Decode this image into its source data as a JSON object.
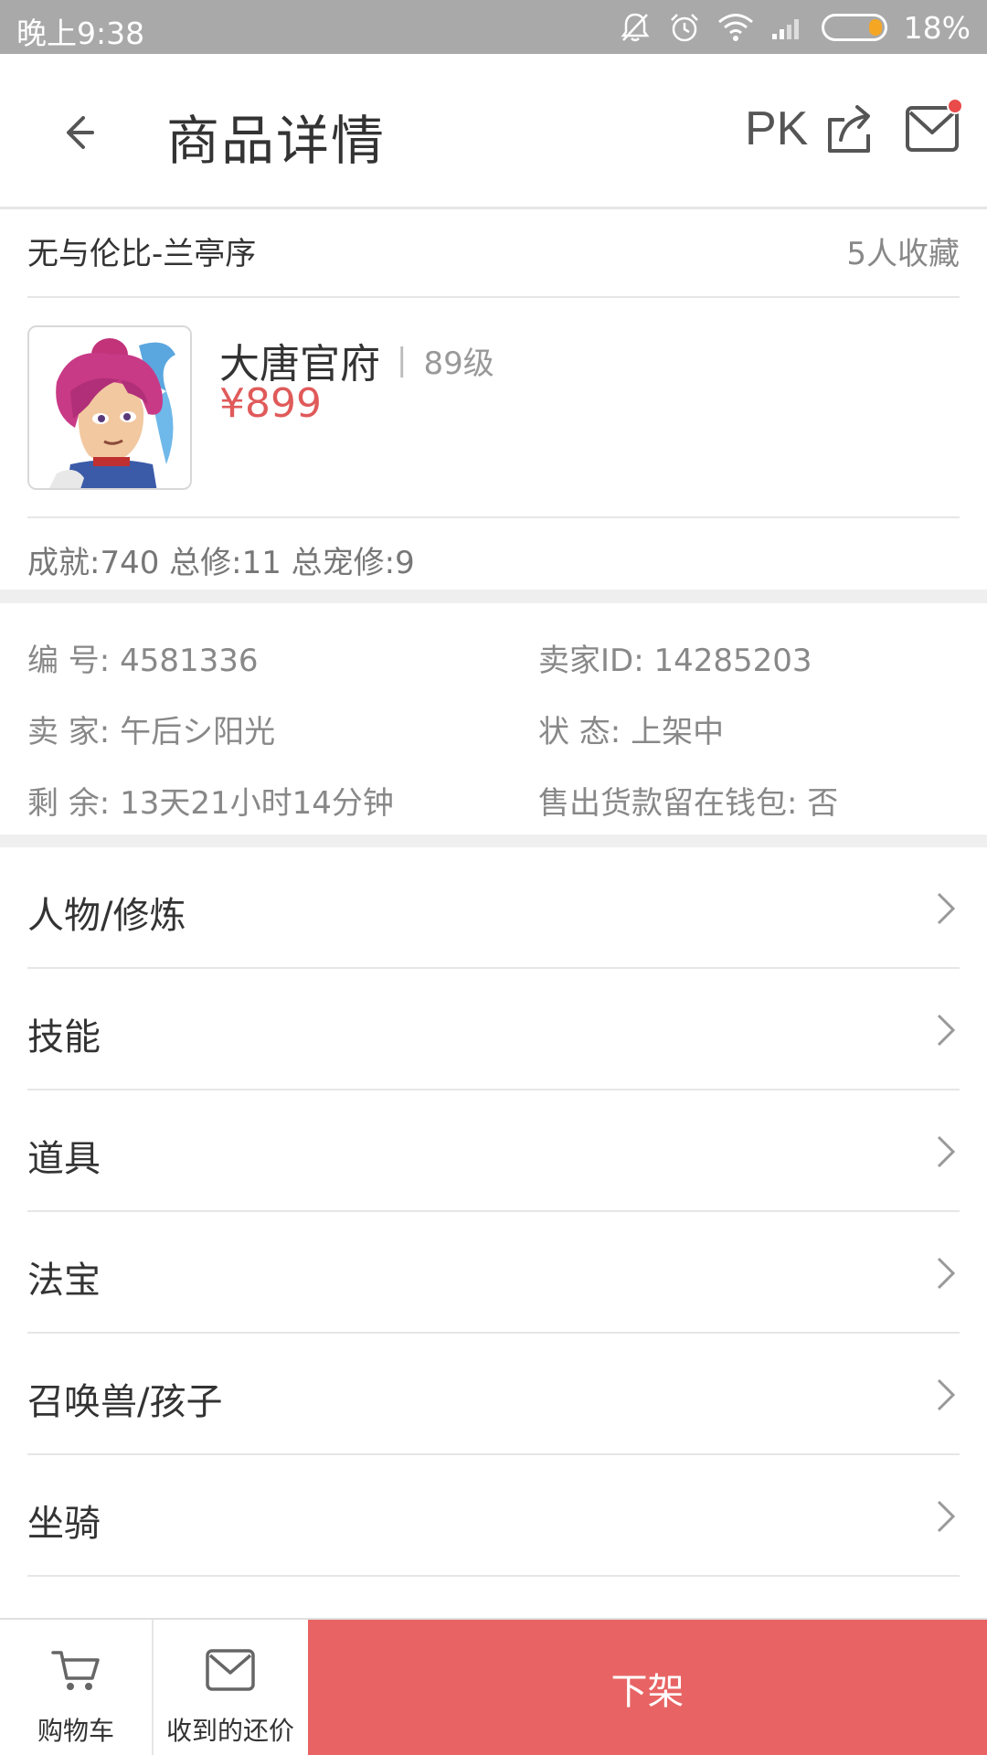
{
  "status_bar": {
    "time": "晚上9:38",
    "battery_percent": "18%",
    "icons": [
      "mute-icon",
      "alarm-icon",
      "wifi-icon",
      "signal-icon",
      "battery-icon"
    ]
  },
  "header": {
    "title": "商品详情",
    "pk_label": "PK",
    "icons": [
      "back-arrow-icon",
      "share-icon",
      "mail-icon"
    ]
  },
  "product": {
    "server": "无与伦比-兰亭序",
    "favorites": "5人收藏",
    "role_name": "大唐官府",
    "divider": "|",
    "level": "89级",
    "price": "¥899",
    "stats": "成就:740 总修:11 总宠修:9"
  },
  "info": {
    "number": "编  号: 4581336",
    "seller_id": "卖家ID: 14285203",
    "seller": "卖  家: 午后シ阳光",
    "status": "状  态: 上架中",
    "remaining": "剩  余: 13天21小时14分钟",
    "wallet": "售出货款留在钱包: 否"
  },
  "menu": [
    {
      "label": "人物/修炼"
    },
    {
      "label": "技能"
    },
    {
      "label": "道具"
    },
    {
      "label": "法宝"
    },
    {
      "label": "召唤兽/孩子"
    },
    {
      "label": "坐骑"
    }
  ],
  "bottom_bar": {
    "cart_label": "购物车",
    "offers_label": "收到的还价",
    "delist_label": "下架"
  },
  "colors": {
    "accent": "#e86464",
    "price": "#e05a5a",
    "status_bar": "#a9a9a9"
  }
}
